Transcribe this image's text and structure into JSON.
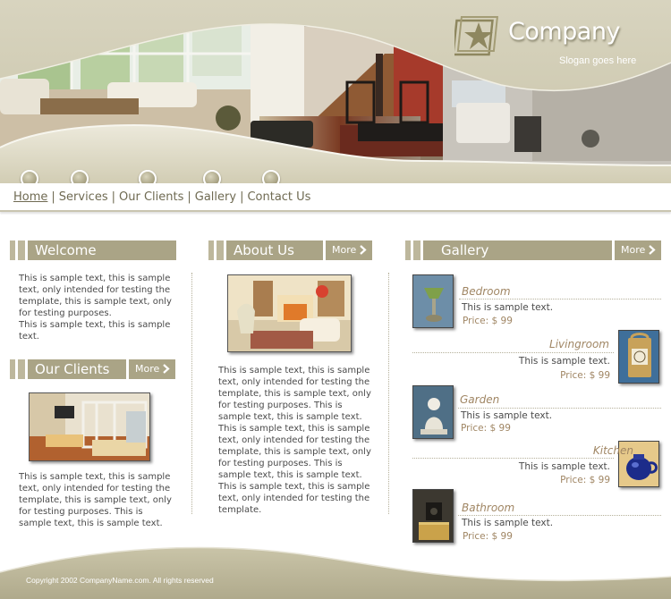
{
  "header": {
    "company_name": "Company",
    "slogan": "Slogan goes here"
  },
  "nav": {
    "items": [
      "Home",
      "Services",
      "Our Clients",
      "Gallery",
      "Contact Us"
    ],
    "separator": "|"
  },
  "welcome": {
    "title": "Welcome",
    "text": "This is sample text, this is sample text, only intended for testing the template, this is sample  text, only for testing purposes.\nThis is sample text, this is sample text."
  },
  "clients": {
    "title": "Our Clients",
    "more_label": "More",
    "text": "This is sample text, this is sample text, only intended for testing the template, this is sample  text, only for testing purposes. This is sample text, this is sample text."
  },
  "about": {
    "title": "About Us",
    "more_label": "More",
    "text": "This is sample text, this is sample text, only intended for testing the template, this is sample  text, only for testing purposes. This is sample text, this is sample text. This is sample text, this is sample text, only intended for testing the template, this is sample  text, only for testing purposes. This is sample text, this is sample text. This is sample text, this is sample text, only intended for testing the template."
  },
  "gallery": {
    "title": "Gallery",
    "more_label": "More",
    "items": [
      {
        "title": "Bedroom",
        "text": "This is sample text.",
        "price": "Price: $ 99"
      },
      {
        "title": "Livingroom",
        "text": "This is sample text.",
        "price": "Price: $ 99"
      },
      {
        "title": "Garden",
        "text": "This is sample text.",
        "price": "Price: $ 99"
      },
      {
        "title": "Kitchen",
        "text": "This is sample text.",
        "price": "Price: $ 99"
      },
      {
        "title": "Bathroom",
        "text": "This is sample text.",
        "price": "Price: $ 99"
      }
    ]
  },
  "footer": {
    "copyright": "Copyright 2002 CompanyName.com. All rights reserved"
  },
  "colors": {
    "accent": "#aaa486",
    "accent_light": "#dad6c2",
    "title_text": "#a08664",
    "nav_text": "#6f6a52"
  }
}
